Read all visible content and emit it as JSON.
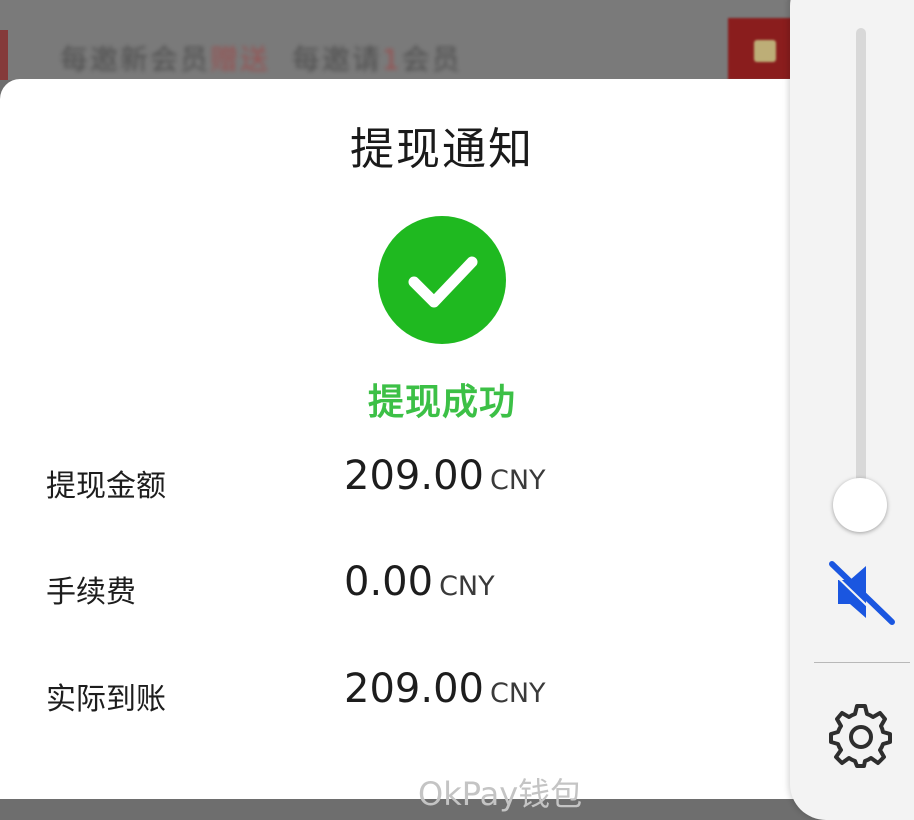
{
  "background": {
    "banner_text_a": "每邀新会员",
    "banner_text_a_red": "赠送",
    "banner_text_b": "每邀请",
    "banner_text_b_red": "1",
    "banner_text_c": "会员"
  },
  "dialog": {
    "title": "提现通知",
    "status": "提现成功",
    "status_color": "#3cc046",
    "success_icon_color": "#1fb920",
    "rows": [
      {
        "label": "提现金额",
        "amount": "209.00",
        "currency": "CNY"
      },
      {
        "label": "手续费",
        "amount": "0.00",
        "currency": "CNY"
      },
      {
        "label": "实际到账",
        "amount": "209.00",
        "currency": "CNY"
      }
    ],
    "footer": "OkPay钱包"
  },
  "volume_panel": {
    "level": 0.0,
    "muted": true,
    "mute_icon": "volume-mute-icon",
    "settings_icon": "gear-icon",
    "accent_color": "#1a56e0"
  }
}
